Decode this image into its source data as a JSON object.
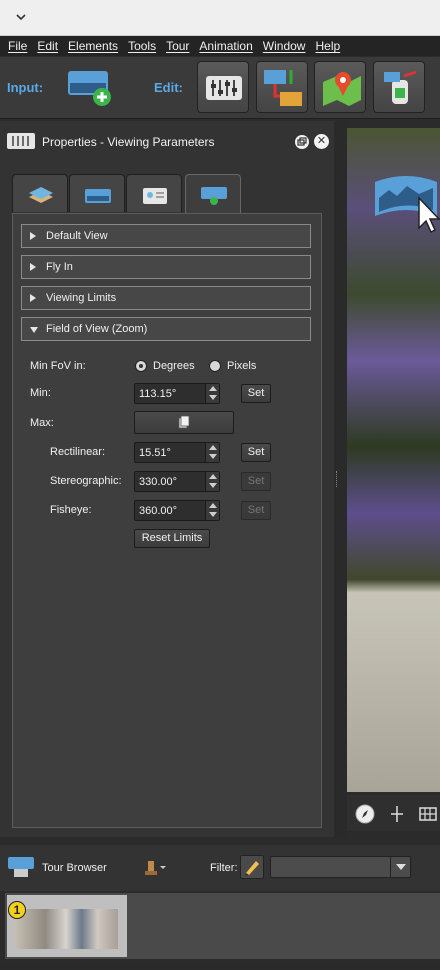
{
  "menu": [
    "File",
    "Edit",
    "Elements",
    "Tools",
    "Tour",
    "Animation",
    "Window",
    "Help"
  ],
  "toolbar": {
    "input_label": "Input:",
    "edit_label": "Edit:"
  },
  "properties": {
    "title": "Properties - Viewing Parameters",
    "sections": [
      {
        "label": "Default View",
        "expanded": false
      },
      {
        "label": "Fly In",
        "expanded": false
      },
      {
        "label": "Viewing Limits",
        "expanded": false
      },
      {
        "label": "Field of View (Zoom)",
        "expanded": true
      }
    ],
    "fov": {
      "min_fov_in_label": "Min FoV in:",
      "degrees_label": "Degrees",
      "pixels_label": "Pixels",
      "selected_unit": "Degrees",
      "min_label": "Min:",
      "min_value": "113.15°",
      "max_label": "Max:",
      "rectilinear_label": "Rectilinear:",
      "rectilinear_value": "15.51°",
      "stereographic_label": "Stereographic:",
      "stereographic_value": "330.00°",
      "fisheye_label": "Fisheye:",
      "fisheye_value": "360.00°",
      "set_label": "Set",
      "reset_label": "Reset Limits"
    }
  },
  "tour_browser": {
    "title": "Tour Browser",
    "filter_label": "Filter:",
    "filter_value": "",
    "thumbnails": [
      {
        "number": "1"
      }
    ]
  },
  "colors": {
    "accent": "#5aa9e6",
    "badge": "#f2d21b"
  }
}
